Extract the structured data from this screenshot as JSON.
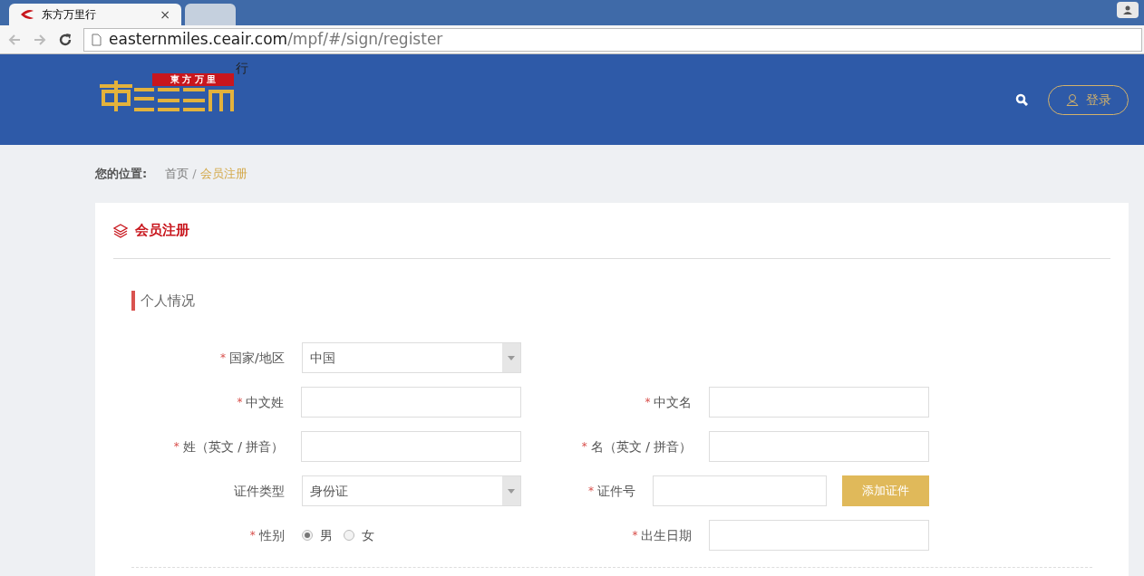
{
  "browser": {
    "tabs": [
      {
        "title": "东方万里行",
        "close": "×",
        "selected": true
      },
      {
        "selected": false
      }
    ],
    "nav": {
      "back_disabled": true,
      "forward_disabled": true
    },
    "url": {
      "host": "easternmiles.ceair.com",
      "path": "/mpf/#/sign/register"
    }
  },
  "header": {
    "logo": {
      "banner": "東 方 万 里",
      "mark": "行"
    },
    "login": "登录"
  },
  "breadcrumb": {
    "label": "您的位置:",
    "items": [
      {
        "text": "首页",
        "current": false
      },
      {
        "text": "会员注册",
        "current": true
      }
    ],
    "separator": "/"
  },
  "card": {
    "title": "会员注册",
    "section": "个人情况",
    "rows": [
      [
        {
          "kind": "select",
          "mark": "*",
          "label": "国家/地区",
          "value": "中国"
        }
      ],
      [
        {
          "kind": "text",
          "mark": "*",
          "label": "中文姓"
        },
        {
          "kind": "text",
          "mark": "*",
          "label": "中文名"
        }
      ],
      [
        {
          "kind": "text",
          "mark": "*",
          "label": "姓（英文 / 拼音）"
        },
        {
          "kind": "text",
          "mark": "*",
          "label": "名（英文 / 拼音）"
        }
      ],
      [
        {
          "kind": "select",
          "label": "证件类型",
          "value": "身份证"
        },
        {
          "kind": "text",
          "mark": "*",
          "label": "证件号",
          "button": "添加证件"
        }
      ],
      [
        {
          "kind": "radio",
          "mark": "*",
          "label": "性别",
          "options": [
            {
              "text": "男",
              "selected": true
            },
            {
              "text": "女",
              "selected": false
            }
          ]
        },
        {
          "kind": "text",
          "mark": "*",
          "label": "出生日期"
        }
      ]
    ]
  }
}
